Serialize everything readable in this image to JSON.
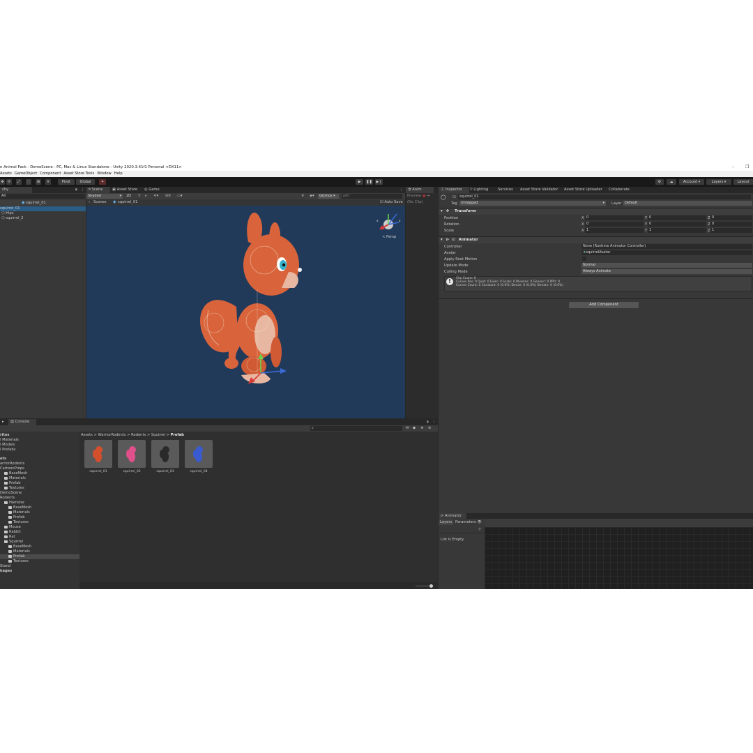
{
  "window": {
    "title": "n Animal Pack - DemoScene - PC, Mac & Linux Standalone - Unity 2020.3.41f1 Personal <DX11>",
    "minimize": "–",
    "maximize": "❐"
  },
  "menu": [
    "Assets",
    "GameObject",
    "Component",
    "Asset Store Tools",
    "Window",
    "Help"
  ],
  "toolbar": {
    "pivot": "Pivot",
    "global": "Global",
    "account": "Account",
    "layers": "Layers",
    "layout": "Layout"
  },
  "hierarchy": {
    "tab": "chy",
    "search": "All",
    "scene_name": "squirrel_01",
    "items": [
      "squirrel_01",
      "Hips",
      "squirrel_2"
    ]
  },
  "scene": {
    "tabs": [
      "Scene",
      "Asset Store",
      "Game"
    ],
    "shading": "Shaded",
    "mode_2d": "2D",
    "gizmos": "Gizmos",
    "gizmo_search": "All",
    "breadcrumb_root": "Scenes",
    "breadcrumb_current": "squirrel_01",
    "auto_save": "Auto Save",
    "persp": "< Persp",
    "axis_x": "x",
    "axis_z": "z"
  },
  "animation": {
    "tab": "Anim",
    "preview": "Preview",
    "no_clip": "(No Clip)"
  },
  "inspector": {
    "tabs": [
      "Inspector",
      "Lighting",
      "Services",
      "Asset Store Validator",
      "Asset Store Uploader",
      "Collaborate"
    ],
    "object_name": "squirrel_01",
    "tag_label": "Tag",
    "tag_value": "Untagged",
    "layer_label": "Layer",
    "layer_value": "Default",
    "transform": {
      "title": "Transform",
      "rows": [
        {
          "label": "Position",
          "x": "0",
          "y": "0",
          "z": "0"
        },
        {
          "label": "Rotation",
          "x": "0",
          "y": "0",
          "z": "0"
        },
        {
          "label": "Scale",
          "x": "1",
          "y": "1",
          "z": "1"
        }
      ],
      "axes": [
        "X",
        "Y",
        "Z"
      ]
    },
    "animator": {
      "title": "Animator",
      "fields": [
        {
          "label": "Controller",
          "value": "None (Runtime Animator Controller)"
        },
        {
          "label": "Avatar",
          "value": "squirrelAvatar"
        },
        {
          "label": "Apply Root Motion",
          "value": ""
        },
        {
          "label": "Update Mode",
          "value": "Normal"
        },
        {
          "label": "Culling Mode",
          "value": "Always Animate"
        }
      ],
      "info_lines": [
        "Clip Count: 0",
        "Curves Pos: 0 Quat: 0 Euler: 0 Scale: 0 Muscles: 0 Generic: 0 PPtr: 0",
        "Curves Count: 0 Constant: 0 (0.0%) Dense: 0 (0.0%) Stream: 0 (0.0%)"
      ]
    },
    "add_component": "Add Component"
  },
  "project": {
    "tab": "Console",
    "breadcrumb": [
      "Assets",
      "WarriorRodents",
      "Rodents",
      "Squirrel",
      "Prefab"
    ],
    "tree": [
      {
        "label": "rites",
        "indent": 0,
        "folder": false,
        "bold": true
      },
      {
        "label": "l Materials",
        "indent": 0,
        "folder": false
      },
      {
        "label": "l Models",
        "indent": 0,
        "folder": false
      },
      {
        "label": "l Prefabs",
        "indent": 0,
        "folder": false
      },
      {
        "label": "ets",
        "indent": 0,
        "folder": false,
        "bold": true,
        "gap": true
      },
      {
        "label": "arriorRodents",
        "indent": 0,
        "folder": false
      },
      {
        "label": "CartoonProps",
        "indent": 0,
        "folder": false
      },
      {
        "label": "BaseMesh",
        "indent": 1,
        "folder": true
      },
      {
        "label": "Materials",
        "indent": 1,
        "folder": true
      },
      {
        "label": "Prefab",
        "indent": 1,
        "folder": true
      },
      {
        "label": "Textures",
        "indent": 1,
        "folder": true
      },
      {
        "label": "DemoScene",
        "indent": 0,
        "folder": false
      },
      {
        "label": "Rodents",
        "indent": 0,
        "folder": false
      },
      {
        "label": "Hamster",
        "indent": 1,
        "folder": true
      },
      {
        "label": "BaseMesh",
        "indent": 2,
        "folder": true
      },
      {
        "label": "Materials",
        "indent": 2,
        "folder": true
      },
      {
        "label": "Prefab",
        "indent": 2,
        "folder": true
      },
      {
        "label": "Textures",
        "indent": 2,
        "folder": true
      },
      {
        "label": "Mouse",
        "indent": 1,
        "folder": true
      },
      {
        "label": "Rabbit",
        "indent": 1,
        "folder": true
      },
      {
        "label": "Rat",
        "indent": 1,
        "folder": true
      },
      {
        "label": "Squirrel",
        "indent": 1,
        "folder": true
      },
      {
        "label": "BaseMesh",
        "indent": 2,
        "folder": true
      },
      {
        "label": "Materials",
        "indent": 2,
        "folder": true
      },
      {
        "label": "Prefab",
        "indent": 2,
        "folder": true,
        "selected": true
      },
      {
        "label": "Textures",
        "indent": 2,
        "folder": true
      },
      {
        "label": "Stand",
        "indent": 0,
        "folder": false
      },
      {
        "label": "kages",
        "indent": 0,
        "folder": false,
        "bold": true
      }
    ],
    "assets": [
      {
        "label": "squirrel_01",
        "color": "#d4502d"
      },
      {
        "label": "squirrel_02",
        "color": "#e0508a"
      },
      {
        "label": "squirrel_03",
        "color": "#2a2a2a"
      },
      {
        "label": "squirrel_04",
        "color": "#3a5ad0"
      }
    ]
  },
  "animator_window": {
    "tab": "Animator",
    "sub_tabs": [
      "Layers",
      "Parameters"
    ],
    "add": "+",
    "empty": "List is Empty"
  },
  "colors": {
    "scene_bg": "#223a5a",
    "panel_bg": "#383838",
    "squirrel_body": "#d9643c",
    "squirrel_belly": "#e8b7a2",
    "selection": "#2c5d87"
  }
}
